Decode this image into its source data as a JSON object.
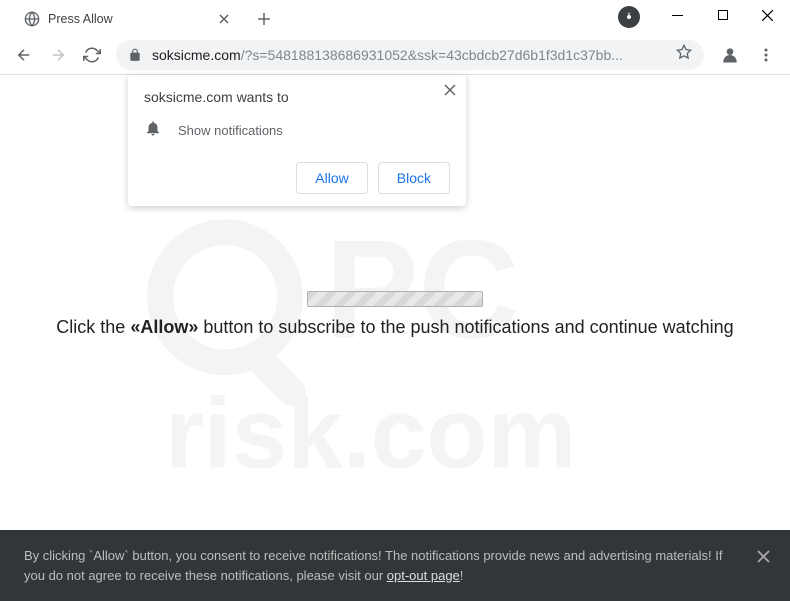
{
  "window": {
    "tab_title": "Press Allow"
  },
  "omnibox": {
    "domain": "soksicme.com",
    "path": "/?s=548188138686931052&ssk=43cbdcb27d6b1f3d1c37bb..."
  },
  "notification_popup": {
    "title": "soksicme.com wants to",
    "permission_text": "Show notifications",
    "allow_label": "Allow",
    "block_label": "Block"
  },
  "page": {
    "instruction_prefix": "Click the ",
    "instruction_bold": "«Allow»",
    "instruction_suffix": " button to subscribe to the push notifications and continue watching"
  },
  "consent": {
    "text_1": "By clicking `Allow` button, you consent to receive notifications! The notifications provide news and advertising materials! If you do not agree to receive these notifications, please visit our ",
    "link_text": "opt-out page",
    "text_2": "!"
  },
  "watermark": {
    "top": "PC",
    "bottom": "risk.com"
  }
}
